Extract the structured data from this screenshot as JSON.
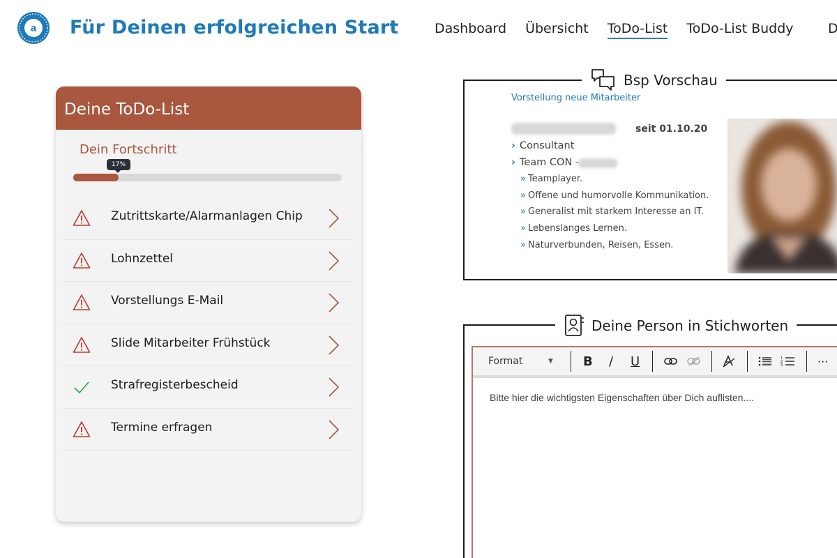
{
  "app": {
    "title": "Für Deinen erfolgreichen Start",
    "logo_letter": "a"
  },
  "nav": {
    "items": [
      {
        "label": "Dashboard"
      },
      {
        "label": "Übersicht"
      },
      {
        "label": "ToDo-List",
        "active": true
      },
      {
        "label": "ToDo-List Buddy"
      }
    ],
    "clipped_item": "D"
  },
  "todo": {
    "title": "Deine ToDo-List",
    "progress": {
      "label": "Dein Fortschritt",
      "percent_text": "17%",
      "value": 0.17
    },
    "items": [
      {
        "label": "Zutrittskarte/Alarmanlagen Chip",
        "status": "warning"
      },
      {
        "label": "Lohnzettel",
        "status": "warning"
      },
      {
        "label": "Vorstellungs E-Mail",
        "status": "warning"
      },
      {
        "label": "Slide Mitarbeiter Frühstück",
        "status": "warning"
      },
      {
        "label": "Strafregisterbescheid",
        "status": "done"
      },
      {
        "label": "Termine erfragen",
        "status": "warning"
      }
    ]
  },
  "preview": {
    "title": "Bsp Vorschau",
    "subtitle": "Vorstellung neue Mitarbeiter",
    "since": "seit 01.10.20",
    "roles": [
      "Consultant",
      "Team CON -"
    ],
    "traits": [
      "Teamplayer.",
      "Offene und humorvolle Kommunikation.",
      "Generalist mit starkem Interesse an IT.",
      "Lebenslanges Lernen.",
      "Naturverbunden, Reisen, Essen."
    ]
  },
  "person": {
    "title": "Deine Person in Stichworten",
    "toolbar": {
      "format_label": "Format",
      "bold": "B",
      "italic": "/",
      "underline": "U",
      "more": "···"
    },
    "placeholder": "Bitte hier die wichtigsten Eigenschaften über Dich auflisten...."
  },
  "colors": {
    "brand_blue": "#1f7ab8",
    "accent_rust": "#a9573e",
    "warning_red": "#c0392b",
    "done_green": "#2e9e3e"
  }
}
